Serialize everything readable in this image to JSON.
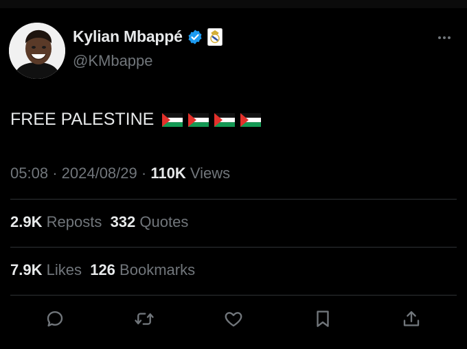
{
  "user": {
    "display_name": "Kylian Mbappé",
    "handle": "@KMbappe",
    "verified_icon": "verified-badge-icon",
    "affiliate_icon": "real-madrid-crest-icon",
    "avatar_icon": "profile-photo"
  },
  "more_icon": "more-options-icon",
  "tweet": {
    "text": "FREE PALESTINE",
    "flag_icons": [
      "palestine-flag-icon",
      "palestine-flag-icon",
      "palestine-flag-icon",
      "palestine-flag-icon"
    ]
  },
  "meta": {
    "time": "05:08",
    "separator": "·",
    "date": "2024/08/29",
    "views_count": "110K",
    "views_label": "Views"
  },
  "stats": {
    "reposts_count": "2.9K",
    "reposts_label": "Reposts",
    "quotes_count": "332",
    "quotes_label": "Quotes",
    "likes_count": "7.9K",
    "likes_label": "Likes",
    "bookmarks_count": "126",
    "bookmarks_label": "Bookmarks"
  },
  "actions": [
    "reply-icon",
    "repost-icon",
    "like-icon",
    "bookmark-icon",
    "share-icon"
  ],
  "colors": {
    "background": "#000000",
    "text_primary": "#e7e9ea",
    "text_secondary": "#71767b",
    "divider": "#2f3336",
    "verified_blue": "#1d9bf0"
  }
}
